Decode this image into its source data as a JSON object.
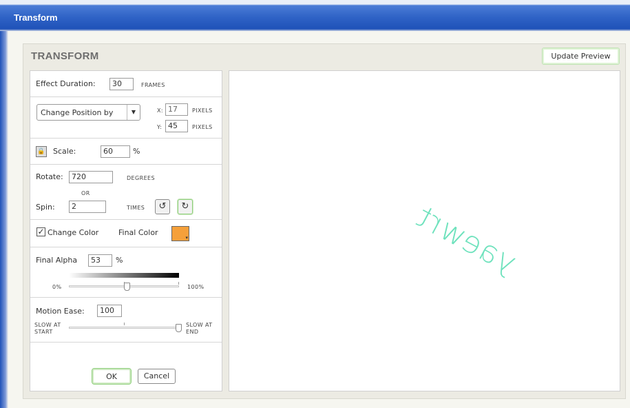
{
  "window": {
    "title": "Transform"
  },
  "panel": {
    "heading": "TRANSFORM",
    "update_preview_label": "Update Preview"
  },
  "effect": {
    "label": "Effect Duration:",
    "value": "30",
    "unit": "FRAMES"
  },
  "position": {
    "mode": "Change Position by",
    "x_label": "X:",
    "x_value": "17",
    "y_label": "Y:",
    "y_value": "45",
    "unit": "PIXELS"
  },
  "scale": {
    "label": "Scale:",
    "value": "60",
    "unit": "%"
  },
  "rotate": {
    "label": "Rotate:",
    "value": "720",
    "unit": "DEGREES",
    "or_label": "OR"
  },
  "spin": {
    "label": "Spin:",
    "value": "2",
    "unit": "TIMES",
    "ccw_selected": false,
    "cw_selected": true
  },
  "color": {
    "checkbox_label": "Change Color",
    "checked": true,
    "final_label": "Final Color",
    "swatch_color": "#f5a03a"
  },
  "alpha": {
    "label": "Final Alpha",
    "value": "53",
    "unit": "%",
    "min_label": "0%",
    "max_label": "100%",
    "slider_fraction": 0.53
  },
  "ease": {
    "label": "Motion Ease:",
    "value": "100",
    "start_label_1": "SLOW AT",
    "start_label_2": "START",
    "end_label_1": "SLOW AT",
    "end_label_2": "END",
    "slider_fraction": 1.0
  },
  "buttons": {
    "ok": "OK",
    "cancel": "Cancel"
  },
  "preview": {
    "text": "yaewrt",
    "text_color": "#6fe2bd"
  }
}
